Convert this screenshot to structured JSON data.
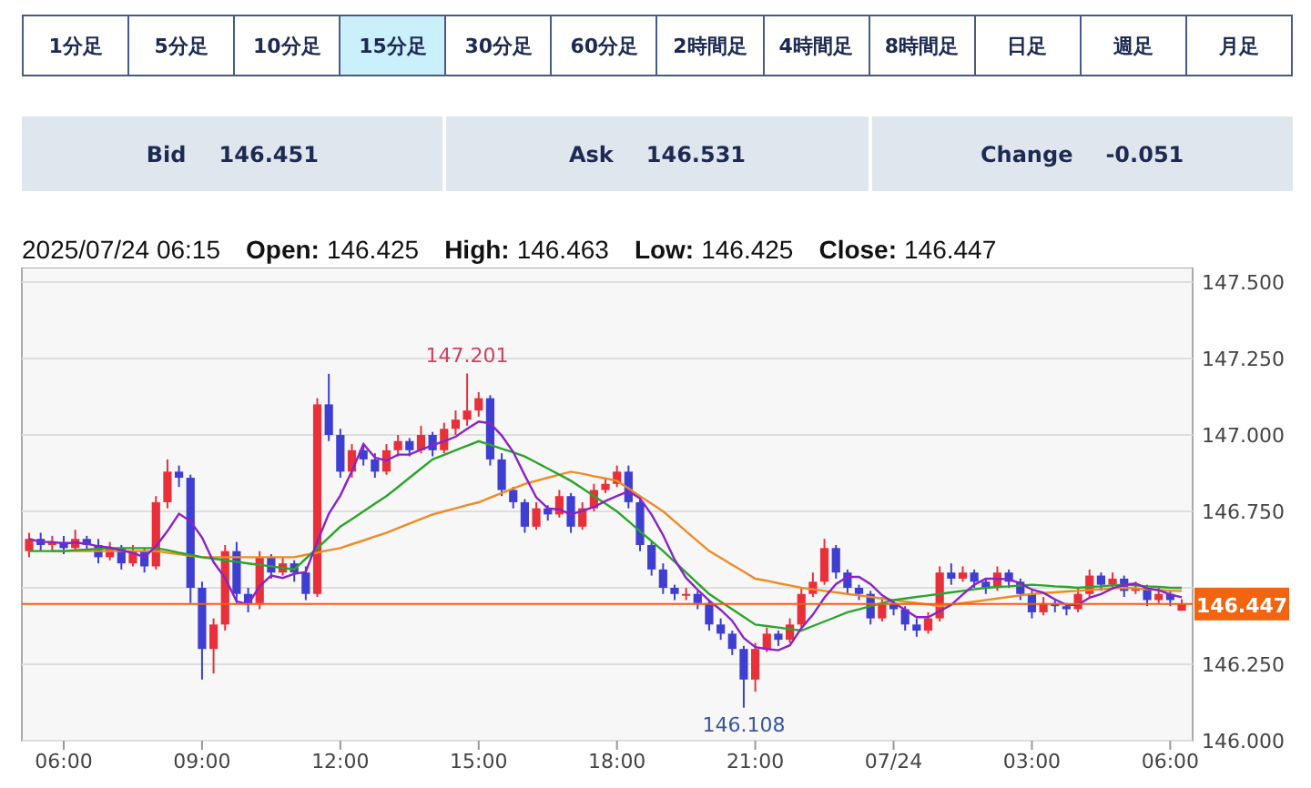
{
  "timeframe_tabs": [
    {
      "label": "1分足",
      "selected": false
    },
    {
      "label": "5分足",
      "selected": false
    },
    {
      "label": "10分足",
      "selected": false
    },
    {
      "label": "15分足",
      "selected": true
    },
    {
      "label": "30分足",
      "selected": false
    },
    {
      "label": "60分足",
      "selected": false
    },
    {
      "label": "2時間足",
      "selected": false
    },
    {
      "label": "4時間足",
      "selected": false
    },
    {
      "label": "8時間足",
      "selected": false
    },
    {
      "label": "日足",
      "selected": false
    },
    {
      "label": "週足",
      "selected": false
    },
    {
      "label": "月足",
      "selected": false
    }
  ],
  "quotes": [
    {
      "label": "Bid",
      "value": "146.451"
    },
    {
      "label": "Ask",
      "value": "146.531"
    },
    {
      "label": "Change",
      "value": "-0.051"
    }
  ],
  "ohlc": {
    "datetime": "2025/07/24 06:15",
    "fields": [
      {
        "label": "Open:",
        "value": "146.425"
      },
      {
        "label": "High:",
        "value": "146.463"
      },
      {
        "label": "Low:",
        "value": "146.425"
      },
      {
        "label": "Close:",
        "value": "146.447"
      }
    ]
  },
  "chart": {
    "chart_data": {
      "type": "candlestick",
      "categories": [
        null,
        null,
        null,
        "06:00",
        null,
        null,
        null,
        null,
        null,
        null,
        null,
        null,
        null,
        null,
        null,
        "09:00",
        null,
        null,
        null,
        null,
        null,
        null,
        null,
        null,
        null,
        null,
        null,
        "12:00",
        null,
        null,
        null,
        null,
        null,
        null,
        null,
        null,
        null,
        null,
        null,
        "15:00",
        null,
        null,
        null,
        null,
        null,
        null,
        null,
        null,
        null,
        null,
        null,
        "18:00",
        null,
        null,
        null,
        null,
        null,
        null,
        null,
        null,
        null,
        null,
        null,
        "21:00",
        null,
        null,
        null,
        null,
        null,
        null,
        null,
        null,
        null,
        null,
        null,
        "07/24",
        null,
        null,
        null,
        null,
        null,
        null,
        null,
        null,
        null,
        null,
        null,
        "03:00",
        null,
        null,
        null,
        null,
        null,
        null,
        null,
        null,
        null,
        null,
        null,
        "06:00",
        null
      ],
      "ohlc": [
        [
          146.62,
          146.68,
          146.6,
          146.66
        ],
        [
          146.66,
          146.68,
          146.62,
          146.64
        ],
        [
          146.64,
          146.67,
          146.62,
          146.65
        ],
        [
          146.65,
          146.67,
          146.61,
          146.63
        ],
        [
          146.63,
          146.69,
          146.62,
          146.66
        ],
        [
          146.66,
          146.67,
          146.62,
          146.64
        ],
        [
          146.64,
          146.66,
          146.58,
          146.6
        ],
        [
          146.6,
          146.65,
          146.59,
          146.63
        ],
        [
          146.63,
          146.64,
          146.56,
          146.58
        ],
        [
          146.58,
          146.64,
          146.57,
          146.62
        ],
        [
          146.62,
          146.63,
          146.55,
          146.57
        ],
        [
          146.57,
          146.8,
          146.56,
          146.78
        ],
        [
          146.78,
          146.92,
          146.76,
          146.88
        ],
        [
          146.88,
          146.9,
          146.83,
          146.86
        ],
        [
          146.86,
          146.87,
          146.45,
          146.5
        ],
        [
          146.5,
          146.52,
          146.2,
          146.3
        ],
        [
          146.3,
          146.4,
          146.22,
          146.38
        ],
        [
          146.38,
          146.64,
          146.36,
          146.62
        ],
        [
          146.62,
          146.65,
          146.45,
          146.48
        ],
        [
          146.48,
          146.5,
          146.42,
          146.45
        ],
        [
          146.45,
          146.62,
          146.43,
          146.6
        ],
        [
          146.6,
          146.61,
          146.53,
          146.55
        ],
        [
          146.55,
          146.6,
          146.54,
          146.58
        ],
        [
          146.58,
          146.59,
          146.52,
          146.55
        ],
        [
          146.55,
          146.57,
          146.46,
          146.48
        ],
        [
          146.48,
          147.12,
          146.47,
          147.1
        ],
        [
          147.1,
          147.2,
          146.98,
          147.0
        ],
        [
          147.0,
          147.02,
          146.86,
          146.88
        ],
        [
          146.88,
          146.97,
          146.86,
          146.95
        ],
        [
          146.95,
          146.97,
          146.9,
          146.92
        ],
        [
          146.92,
          146.94,
          146.86,
          146.88
        ],
        [
          146.88,
          146.97,
          146.87,
          146.95
        ],
        [
          146.95,
          147.0,
          146.93,
          146.98
        ],
        [
          146.98,
          146.99,
          146.93,
          146.95
        ],
        [
          146.95,
          147.03,
          146.94,
          147.0
        ],
        [
          147.0,
          147.01,
          146.93,
          146.95
        ],
        [
          146.95,
          147.04,
          146.94,
          147.02
        ],
        [
          147.02,
          147.08,
          147.0,
          147.05
        ],
        [
          147.05,
          147.201,
          147.03,
          147.08
        ],
        [
          147.08,
          147.14,
          147.06,
          147.12
        ],
        [
          147.12,
          147.13,
          146.9,
          146.92
        ],
        [
          146.92,
          146.94,
          146.8,
          146.82
        ],
        [
          146.82,
          146.83,
          146.76,
          146.78
        ],
        [
          146.78,
          146.79,
          146.68,
          146.7
        ],
        [
          146.7,
          146.78,
          146.69,
          146.76
        ],
        [
          146.76,
          146.77,
          146.72,
          146.74
        ],
        [
          146.74,
          146.82,
          146.73,
          146.8
        ],
        [
          146.8,
          146.81,
          146.68,
          146.7
        ],
        [
          146.7,
          146.78,
          146.69,
          146.76
        ],
        [
          146.76,
          146.84,
          146.75,
          146.82
        ],
        [
          146.82,
          146.86,
          146.81,
          146.84
        ],
        [
          146.84,
          146.9,
          146.83,
          146.88
        ],
        [
          146.88,
          146.9,
          146.76,
          146.78
        ],
        [
          146.78,
          146.79,
          146.62,
          146.64
        ],
        [
          146.64,
          146.65,
          146.54,
          146.56
        ],
        [
          146.56,
          146.58,
          146.48,
          146.5
        ],
        [
          146.5,
          146.51,
          146.46,
          146.48
        ],
        [
          146.48,
          146.5,
          146.46,
          146.48
        ],
        [
          146.48,
          146.49,
          146.43,
          146.45
        ],
        [
          146.45,
          146.46,
          146.36,
          146.38
        ],
        [
          146.38,
          146.4,
          146.33,
          146.35
        ],
        [
          146.35,
          146.36,
          146.28,
          146.3
        ],
        [
          146.3,
          146.31,
          146.108,
          146.2
        ],
        [
          146.2,
          146.32,
          146.16,
          146.3
        ],
        [
          146.3,
          146.37,
          146.29,
          146.35
        ],
        [
          146.35,
          146.36,
          146.31,
          146.33
        ],
        [
          146.33,
          146.4,
          146.32,
          146.38
        ],
        [
          146.38,
          146.5,
          146.37,
          146.48
        ],
        [
          146.48,
          146.55,
          146.47,
          146.52
        ],
        [
          146.52,
          146.66,
          146.51,
          146.63
        ],
        [
          146.63,
          146.64,
          146.53,
          146.55
        ],
        [
          146.55,
          146.56,
          146.48,
          146.5
        ],
        [
          146.5,
          146.51,
          146.46,
          146.48
        ],
        [
          146.48,
          146.49,
          146.38,
          146.4
        ],
        [
          146.4,
          146.47,
          146.39,
          146.45
        ],
        [
          146.45,
          146.46,
          146.41,
          146.43
        ],
        [
          146.43,
          146.44,
          146.36,
          146.38
        ],
        [
          146.38,
          146.4,
          146.34,
          146.36
        ],
        [
          146.36,
          146.42,
          146.35,
          146.4
        ],
        [
          146.4,
          146.57,
          146.39,
          146.55
        ],
        [
          146.55,
          146.58,
          146.51,
          146.53
        ],
        [
          146.53,
          146.57,
          146.52,
          146.55
        ],
        [
          146.55,
          146.56,
          146.5,
          146.52
        ],
        [
          146.52,
          146.53,
          146.48,
          146.5
        ],
        [
          146.5,
          146.57,
          146.49,
          146.55
        ],
        [
          146.55,
          146.56,
          146.5,
          146.52
        ],
        [
          146.52,
          146.53,
          146.46,
          146.48
        ],
        [
          146.48,
          146.49,
          146.4,
          146.42
        ],
        [
          146.42,
          146.47,
          146.41,
          146.45
        ],
        [
          146.45,
          146.46,
          146.42,
          146.44
        ],
        [
          146.44,
          146.45,
          146.41,
          146.43
        ],
        [
          146.43,
          146.5,
          146.42,
          146.48
        ],
        [
          146.48,
          146.56,
          146.47,
          146.54
        ],
        [
          146.54,
          146.55,
          146.49,
          146.51
        ],
        [
          146.51,
          146.55,
          146.5,
          146.53
        ],
        [
          146.53,
          146.54,
          146.47,
          146.49
        ],
        [
          146.49,
          146.52,
          146.48,
          146.5
        ],
        [
          146.5,
          146.51,
          146.44,
          146.46
        ],
        [
          146.46,
          146.5,
          146.45,
          146.48
        ],
        [
          146.48,
          146.49,
          146.44,
          146.46
        ],
        [
          146.425,
          146.463,
          146.425,
          146.447
        ]
      ],
      "series": [
        {
          "type": "line",
          "color": "#f08a24",
          "values": [
            null,
            null,
            146.62,
            146.62,
            146.62,
            146.62,
            146.62,
            146.62,
            146.62,
            146.62,
            146.62,
            146.62,
            146.615,
            146.61,
            146.605,
            146.6,
            146.6,
            146.6,
            146.6,
            146.6,
            146.6,
            146.6,
            146.6,
            146.6,
            146.608,
            146.615,
            146.623,
            146.63,
            146.643,
            146.655,
            146.668,
            146.68,
            146.695,
            146.71,
            146.725,
            146.74,
            146.75,
            146.76,
            146.77,
            146.78,
            146.795,
            146.81,
            146.825,
            146.84,
            146.85,
            146.86,
            146.87,
            146.88,
            146.873,
            146.865,
            146.858,
            146.85,
            146.825,
            146.8,
            146.775,
            146.75,
            146.718,
            146.685,
            146.653,
            146.62,
            146.598,
            146.575,
            146.553,
            146.53,
            146.523,
            146.515,
            146.508,
            146.5,
            146.495,
            146.49,
            146.485,
            146.48,
            146.475,
            146.47,
            146.465,
            146.46,
            146.455,
            146.45,
            146.445,
            146.44,
            146.445,
            146.45,
            146.455,
            146.46,
            146.465,
            146.47,
            146.475,
            146.48,
            146.483,
            146.485,
            146.488,
            146.49,
            146.493,
            146.495,
            146.498,
            146.5,
            146.498,
            146.495,
            146.493,
            146.49,
            146.49
          ]
        },
        {
          "type": "line",
          "color": "#2aa52a",
          "values": [
            146.62,
            146.62,
            146.62,
            146.62,
            146.623,
            146.625,
            146.628,
            146.63,
            146.63,
            146.63,
            146.63,
            146.63,
            146.623,
            146.615,
            146.608,
            146.6,
            146.595,
            146.59,
            146.585,
            146.58,
            146.575,
            146.57,
            146.565,
            146.56,
            146.595,
            146.63,
            146.665,
            146.7,
            146.725,
            146.75,
            146.775,
            146.8,
            146.83,
            146.86,
            146.89,
            146.92,
            146.935,
            146.95,
            146.965,
            146.98,
            146.968,
            146.955,
            146.943,
            146.93,
            146.91,
            146.89,
            146.87,
            146.85,
            146.825,
            146.8,
            146.775,
            146.75,
            146.718,
            146.685,
            146.653,
            146.62,
            146.585,
            146.55,
            146.515,
            146.48,
            146.455,
            146.43,
            146.405,
            146.38,
            146.375,
            146.37,
            146.365,
            146.36,
            146.375,
            146.39,
            146.405,
            146.42,
            146.43,
            146.44,
            146.45,
            146.46,
            146.465,
            146.47,
            146.475,
            146.48,
            146.485,
            146.49,
            146.495,
            146.5,
            146.503,
            146.505,
            146.508,
            146.51,
            146.508,
            146.505,
            146.503,
            146.5,
            146.503,
            146.505,
            146.508,
            146.51,
            146.508,
            146.505,
            146.503,
            146.5,
            146.5
          ]
        },
        {
          "type": "line",
          "color": "#8a22c8",
          "values": [
            146.66,
            146.65,
            146.65,
            146.645,
            146.648,
            146.644,
            146.636,
            146.632,
            146.622,
            146.614,
            146.6,
            146.636,
            146.686,
            146.742,
            146.718,
            146.664,
            146.584,
            146.532,
            146.456,
            146.446,
            146.506,
            146.54,
            146.532,
            146.546,
            146.552,
            146.652,
            146.742,
            146.802,
            146.882,
            146.97,
            146.926,
            146.916,
            146.936,
            146.936,
            146.952,
            146.966,
            146.98,
            146.994,
            147.02,
            147.044,
            147.038,
            146.998,
            146.944,
            146.868,
            146.796,
            146.76,
            146.756,
            146.74,
            146.752,
            146.764,
            146.784,
            146.8,
            146.816,
            146.792,
            146.74,
            146.672,
            146.592,
            146.532,
            146.494,
            146.458,
            146.428,
            146.392,
            146.336,
            146.306,
            146.3,
            146.296,
            146.312,
            146.368,
            146.412,
            146.468,
            146.512,
            146.536,
            146.536,
            146.512,
            146.476,
            146.452,
            146.428,
            146.404,
            146.404,
            146.424,
            146.444,
            146.478,
            146.51,
            146.53,
            146.53,
            146.528,
            146.514,
            146.494,
            146.484,
            146.462,
            146.444,
            146.444,
            146.468,
            146.48,
            146.498,
            146.51,
            146.514,
            146.498,
            146.492,
            146.478,
            146.469
          ]
        }
      ],
      "grid": true,
      "ref_lines": [
        {
          "axis": "y",
          "value": 146.447,
          "color": "#f06010"
        }
      ],
      "ylim": [
        146.0,
        147.5
      ],
      "yticks": [
        {
          "value": 147.5,
          "label": "147.500"
        },
        {
          "value": 147.25,
          "label": "147.250"
        },
        {
          "value": 147.0,
          "label": "147.000"
        },
        {
          "value": 146.75,
          "label": "146.750"
        },
        {
          "value": 146.25,
          "label": "146.250"
        },
        {
          "value": 146.0,
          "label": "146.000"
        }
      ]
    },
    "high_label": "147.201",
    "low_label": "146.108",
    "last_price": "146.447"
  }
}
